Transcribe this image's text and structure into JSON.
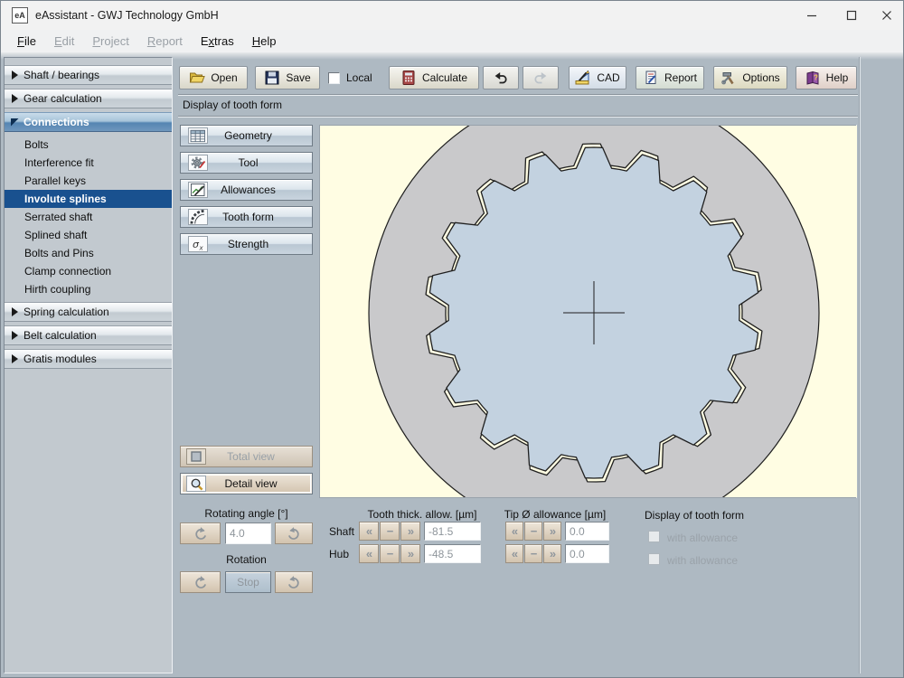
{
  "window": {
    "title": "eAssistant - GWJ Technology GmbH",
    "icon_label": "eA"
  },
  "menu": [
    {
      "label": "File",
      "underline": 0,
      "enabled": true
    },
    {
      "label": "Edit",
      "underline": 0,
      "enabled": false
    },
    {
      "label": "Project",
      "underline": 0,
      "enabled": false
    },
    {
      "label": "Report",
      "underline": 0,
      "enabled": false
    },
    {
      "label": "Extras",
      "underline": 1,
      "enabled": true
    },
    {
      "label": "Help",
      "underline": 0,
      "enabled": true
    }
  ],
  "toolbar": {
    "open": "Open",
    "save": "Save",
    "local": "Local",
    "calculate": "Calculate",
    "cad": "CAD",
    "report": "Report",
    "options": "Options",
    "help": "Help"
  },
  "sidebar": {
    "sections": [
      {
        "label": "Shaft / bearings",
        "expanded": false
      },
      {
        "label": "Gear calculation",
        "expanded": false
      },
      {
        "label": "Connections",
        "expanded": true,
        "items": [
          {
            "label": "Bolts",
            "selected": false
          },
          {
            "label": "Interference fit",
            "selected": false
          },
          {
            "label": "Parallel keys",
            "selected": false
          },
          {
            "label": "Involute splines",
            "selected": true
          },
          {
            "label": "Serrated shaft",
            "selected": false
          },
          {
            "label": "Splined shaft",
            "selected": false
          },
          {
            "label": "Bolts and Pins",
            "selected": false
          },
          {
            "label": "Clamp connection",
            "selected": false
          },
          {
            "label": "Hirth coupling",
            "selected": false
          }
        ]
      },
      {
        "label": "Spring calculation",
        "expanded": false
      },
      {
        "label": "Belt calculation",
        "expanded": false
      },
      {
        "label": "Gratis modules",
        "expanded": false
      }
    ]
  },
  "content": {
    "section_title": "Display of tooth form",
    "stack": {
      "geometry": "Geometry",
      "tool": "Tool",
      "allowances": "Allowances",
      "tooth_form": "Tooth form",
      "strength": "Strength"
    },
    "views": {
      "total": "Total view",
      "detail": "Detail view"
    },
    "rotation_controls": {
      "angle_label": "Rotating angle [°]",
      "angle_value": "4.0",
      "rotation_label": "Rotation",
      "stop_label": "Stop"
    },
    "allowances": {
      "tooth_header": "Tooth thick. allow. [µm]",
      "tip_header": "Tip Ø allowance [µm]",
      "rows": [
        {
          "label": "Shaft",
          "tooth_value": "-81.5",
          "tip_value": "0.0"
        },
        {
          "label": "Hub",
          "tooth_value": "-48.5",
          "tip_value": "0.0"
        }
      ]
    },
    "display_options": {
      "label": "Display of tooth form",
      "options": [
        "with allowance",
        "with allowance"
      ]
    },
    "display": {
      "gear": {
        "teeth": 18,
        "center": [
          303,
          207
        ],
        "disc_radius": 249,
        "shaft_min": 161,
        "shaft_max": 183,
        "hub_min": 164,
        "hub_max": 187,
        "clearance_deg": 0.8,
        "cross_half": 34,
        "colors": {
          "background": "#fffde3",
          "hub_disc": "#c9c9cb",
          "shaft_gear": "#c3d2e0",
          "outline": "#1f1f1f"
        }
      }
    }
  }
}
